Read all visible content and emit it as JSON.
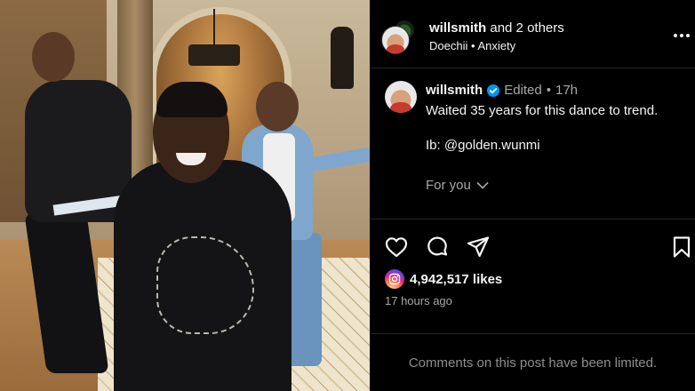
{
  "header": {
    "author": "willsmith",
    "collab_suffix": "and 2 others",
    "audio_artist": "Doechii",
    "separator": "•",
    "audio_track": "Anxiety",
    "more_icon": "more-horizontal-icon"
  },
  "caption": {
    "username": "willsmith",
    "edited_label": "Edited",
    "dot": "•",
    "age": "17h",
    "text_line1": "Waited 35 years for this dance to trend.",
    "text_line2": "Ib: @golden.wunmi",
    "for_you_label": "For you"
  },
  "actions": {
    "like_icon": "heart-icon",
    "comment_icon": "comment-icon",
    "share_icon": "send-icon",
    "save_icon": "bookmark-icon"
  },
  "stats": {
    "likes": "4,942,517 likes",
    "posted": "17 hours ago"
  },
  "comments": {
    "limited_notice": "Comments on this post have been limited."
  },
  "colors": {
    "background": "#000000",
    "text": "#f5f5f5",
    "muted": "#a8a8a8",
    "verified": "#0095f6",
    "divider": "#262626"
  }
}
